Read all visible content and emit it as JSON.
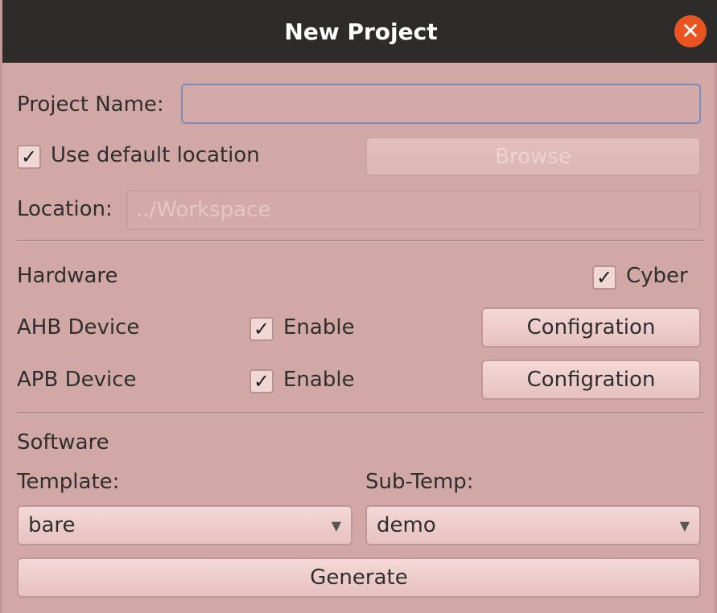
{
  "window": {
    "title": "New Project"
  },
  "project": {
    "name_label": "Project Name:",
    "name_value": "",
    "use_default_label": "Use default location",
    "use_default_checked": true,
    "browse_label": "Browse",
    "location_label": "Location:",
    "location_value": "../Workspace"
  },
  "hardware": {
    "section_label": "Hardware",
    "cyber_label": "Cyber",
    "cyber_checked": true,
    "devices": [
      {
        "name": "AHB Device",
        "enable_label": "Enable",
        "enabled": true,
        "config_label": "Configration"
      },
      {
        "name": "APB Device",
        "enable_label": "Enable",
        "enabled": true,
        "config_label": "Configration"
      }
    ]
  },
  "software": {
    "section_label": "Software",
    "template_label": "Template:",
    "template_value": "bare",
    "subtemp_label": "Sub-Temp:",
    "subtemp_value": "demo",
    "generate_label": "Generate"
  },
  "icons": {
    "close": "close-icon",
    "check": "check-icon",
    "dropdown": "chevron-down-icon"
  },
  "colors": {
    "titlebar": "#2e2c2a",
    "close": "#e95420",
    "background": "#d2a8a7"
  }
}
